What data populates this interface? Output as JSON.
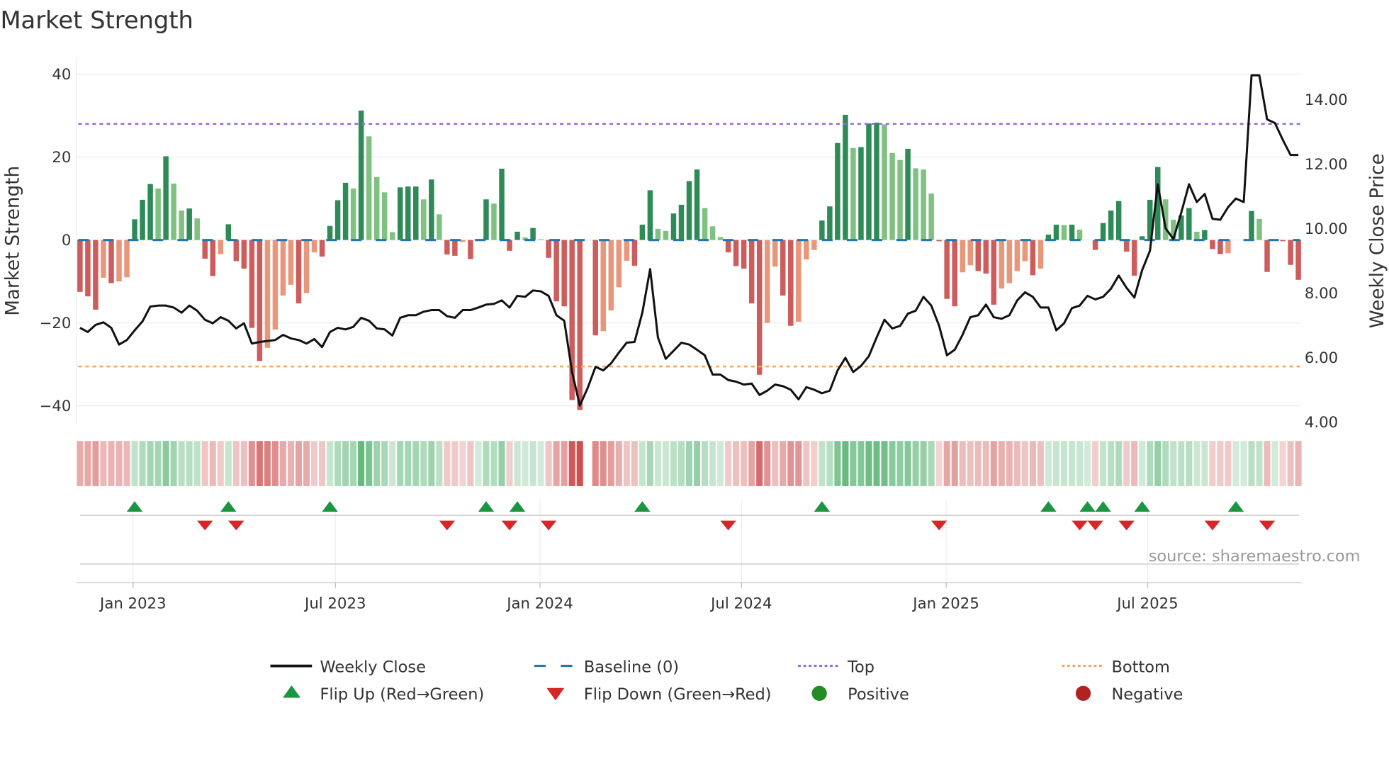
{
  "chart_data": {
    "type": "bar",
    "title": "Market Strength",
    "ylabel": "Market Strength",
    "y2label": "Weekly Close Price",
    "ylim": [
      -44.2,
      44
    ],
    "y2lim": [
      3.96,
      15.3
    ],
    "yticks": [
      {
        "v": 40,
        "label": "40"
      },
      {
        "v": 20,
        "label": "20"
      },
      {
        "v": 0,
        "label": "0"
      },
      {
        "v": -20,
        "label": "−20"
      },
      {
        "v": -40,
        "label": "−40"
      }
    ],
    "y2ticks": [
      {
        "v": 14,
        "label": "14.00"
      },
      {
        "v": 12,
        "label": "12.00"
      },
      {
        "v": 10,
        "label": "10.00"
      },
      {
        "v": 8,
        "label": "8.00"
      },
      {
        "v": 6,
        "label": "6.00"
      },
      {
        "v": 4,
        "label": "4.00"
      }
    ],
    "xticks": [
      {
        "week": 6.8,
        "label": "Jan 2023"
      },
      {
        "week": 32.7,
        "label": "Jul 2023"
      },
      {
        "week": 58.9,
        "label": "Jan 2024"
      },
      {
        "week": 84.7,
        "label": "Jul 2024"
      },
      {
        "week": 110.9,
        "label": "Jan 2025"
      },
      {
        "week": 136.7,
        "label": "Jul 2025"
      }
    ],
    "top_level": 28,
    "bottom_level": -30.5,
    "baseline": 0,
    "strength": [
      -12.5,
      -13.6,
      -16.8,
      -9.1,
      -10.4,
      -10,
      -9,
      5,
      9.7,
      13.5,
      12.4,
      20.2,
      13.6,
      7.1,
      7.6,
      5.2,
      -4.5,
      -8.7,
      -3.4,
      3.8,
      -5.1,
      -6.9,
      -21.2,
      -29.2,
      -26,
      -21.6,
      -13.4,
      -10.8,
      -15.3,
      -12.8,
      -3,
      -4,
      3.4,
      9.6,
      13.8,
      12.4,
      31.2,
      25,
      15.2,
      11.5,
      1.9,
      12.7,
      12.9,
      12.9,
      9.8,
      14.6,
      6.2,
      -3.5,
      -3.8,
      -0.5,
      -4.6,
      0,
      9.8,
      8.8,
      17.2,
      -2.6,
      2,
      0.6,
      2.9,
      0.2,
      -4.3,
      -14.8,
      -16,
      -38.6,
      -41,
      0,
      -23,
      -22,
      -17,
      -11.4,
      -5,
      -6.2,
      3.7,
      12,
      2.7,
      2.2,
      6.4,
      8.5,
      14.2,
      17,
      7.7,
      3.3,
      0.7,
      -3,
      -6.3,
      -6.9,
      -15.3,
      -32.5,
      -20,
      -6.4,
      -13.4,
      -20.7,
      -19.7,
      -4.7,
      -2.4,
      4.7,
      8.1,
      23.4,
      30.2,
      22.2,
      22.4,
      28.1,
      28.3,
      27.9,
      21,
      19.3,
      22,
      17.3,
      17,
      11.2,
      -0.3,
      -14.2,
      -16,
      -7.8,
      -6.1,
      -7.5,
      -8.1,
      -15.6,
      -11.7,
      -10.4,
      -7.5,
      -5.1,
      -8.5,
      -6.9,
      1.3,
      3.7,
      3.6,
      3.7,
      2.5,
      0,
      -2.4,
      4.1,
      7.1,
      9.4,
      -2.8,
      -8.6,
      0.9,
      9.7,
      17.6,
      9.8,
      4.9,
      5.9,
      7.7,
      2,
      2.4,
      -2.2,
      -3.4,
      -3.2,
      0,
      0,
      7,
      5.1,
      -7.7,
      0,
      -0.3,
      -6,
      -9.6
    ],
    "weekly_close": [
      6.92,
      6.79,
      7.01,
      7.09,
      6.92,
      6.4,
      6.54,
      6.84,
      7.12,
      7.58,
      7.61,
      7.61,
      7.55,
      7.39,
      7.61,
      7.45,
      7.17,
      7.06,
      7.25,
      7.14,
      6.9,
      7.06,
      6.43,
      6.48,
      6.51,
      6.54,
      6.7,
      6.59,
      6.54,
      6.43,
      6.57,
      6.32,
      6.79,
      6.92,
      6.87,
      6.95,
      7.23,
      7.14,
      6.9,
      6.87,
      6.68,
      7.23,
      7.31,
      7.31,
      7.42,
      7.47,
      7.47,
      7.28,
      7.23,
      7.47,
      7.47,
      7.55,
      7.64,
      7.66,
      7.77,
      7.55,
      7.91,
      7.88,
      8.08,
      8.05,
      7.91,
      7.31,
      7.14,
      5.55,
      4.51,
      5.05,
      5.71,
      5.6,
      5.82,
      6.15,
      6.46,
      6.48,
      7.39,
      8.74,
      6.62,
      5.96,
      6.21,
      6.46,
      6.4,
      6.24,
      6.07,
      5.47,
      5.47,
      5.3,
      5.25,
      5.16,
      5.19,
      4.84,
      4.97,
      5.16,
      5.11,
      5.0,
      4.7,
      5.08,
      5.0,
      4.89,
      4.97,
      5.6,
      5.99,
      5.55,
      5.74,
      6.04,
      6.62,
      7.17,
      6.9,
      6.98,
      7.36,
      7.45,
      7.88,
      7.61,
      6.98,
      6.07,
      6.24,
      6.7,
      7.25,
      7.31,
      7.64,
      7.25,
      7.2,
      7.31,
      7.77,
      8.02,
      7.88,
      7.55,
      7.55,
      6.84,
      7.06,
      7.53,
      7.61,
      7.91,
      7.8,
      7.88,
      8.13,
      8.54,
      8.16,
      7.86,
      8.71,
      9.31,
      11.37,
      10.0,
      9.67,
      10.49,
      11.37,
      10.82,
      11.07,
      10.3,
      10.27,
      10.66,
      10.93,
      10.82,
      14.75,
      14.75,
      13.38,
      13.27,
      12.75,
      12.28,
      12.28
    ],
    "flip_up_weeks": [
      7,
      19,
      32,
      52,
      56,
      72,
      95,
      124,
      129,
      131,
      136,
      148
    ],
    "flip_down_weeks": [
      16,
      20,
      47,
      55,
      60,
      83,
      110,
      128,
      130,
      134,
      145,
      152
    ],
    "legend": [
      {
        "label": "Weekly Close",
        "kind": "line"
      },
      {
        "label": "Baseline (0)",
        "kind": "dash"
      },
      {
        "label": "Top",
        "kind": "dot-top"
      },
      {
        "label": "Bottom",
        "kind": "dot-bottom"
      },
      {
        "label": "Flip Up (Red→Green)",
        "kind": "tri-up"
      },
      {
        "label": "Flip Down (Green→Red)",
        "kind": "tri-down"
      },
      {
        "label": "Positive",
        "kind": "dot-pos"
      },
      {
        "label": "Negative",
        "kind": "dot-neg"
      }
    ],
    "legend_placement": "bottom",
    "grid": true
  },
  "source": "source: sharemaestro.com",
  "colors": {
    "pos_strong": "#2e8b57",
    "pos_weak": "#80c080",
    "neg_strong": "#cd5c5c",
    "neg_weak": "#e9967a",
    "baseline": "#1f77b4",
    "top": "#9467dd",
    "bottom": "#f4a460",
    "flip_up": "#1a9641",
    "flip_down": "#d62728",
    "positive": "#228b22",
    "negative": "#b22222",
    "line": "#111111"
  }
}
